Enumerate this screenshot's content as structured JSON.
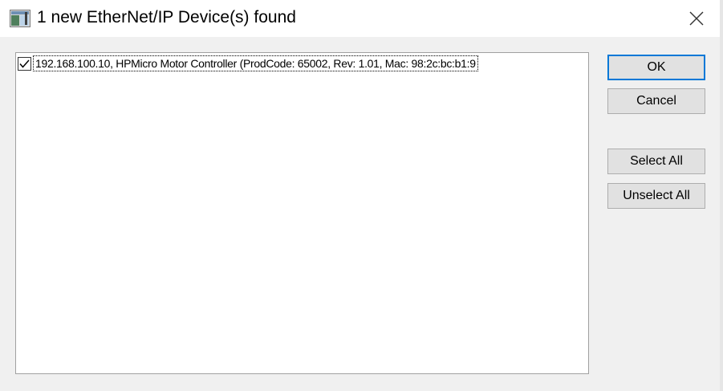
{
  "window": {
    "title": "1 new EtherNet/IP Device(s) found",
    "app_icon": "app-window-icon",
    "close_icon": "close-icon"
  },
  "device_list": {
    "items": [
      {
        "checked": true,
        "label": "192.168.100.10, HPMicro Motor Controller (ProdCode: 65002, Rev: 1.01, Mac: 98:2c:bc:b1:9"
      }
    ]
  },
  "buttons": {
    "ok": "OK",
    "cancel": "Cancel",
    "select_all": "Select All",
    "unselect_all": "Unselect All"
  },
  "colors": {
    "default_button_border": "#0078d7",
    "button_face": "#e1e1e1",
    "dialog_background": "#f0f0f0"
  }
}
